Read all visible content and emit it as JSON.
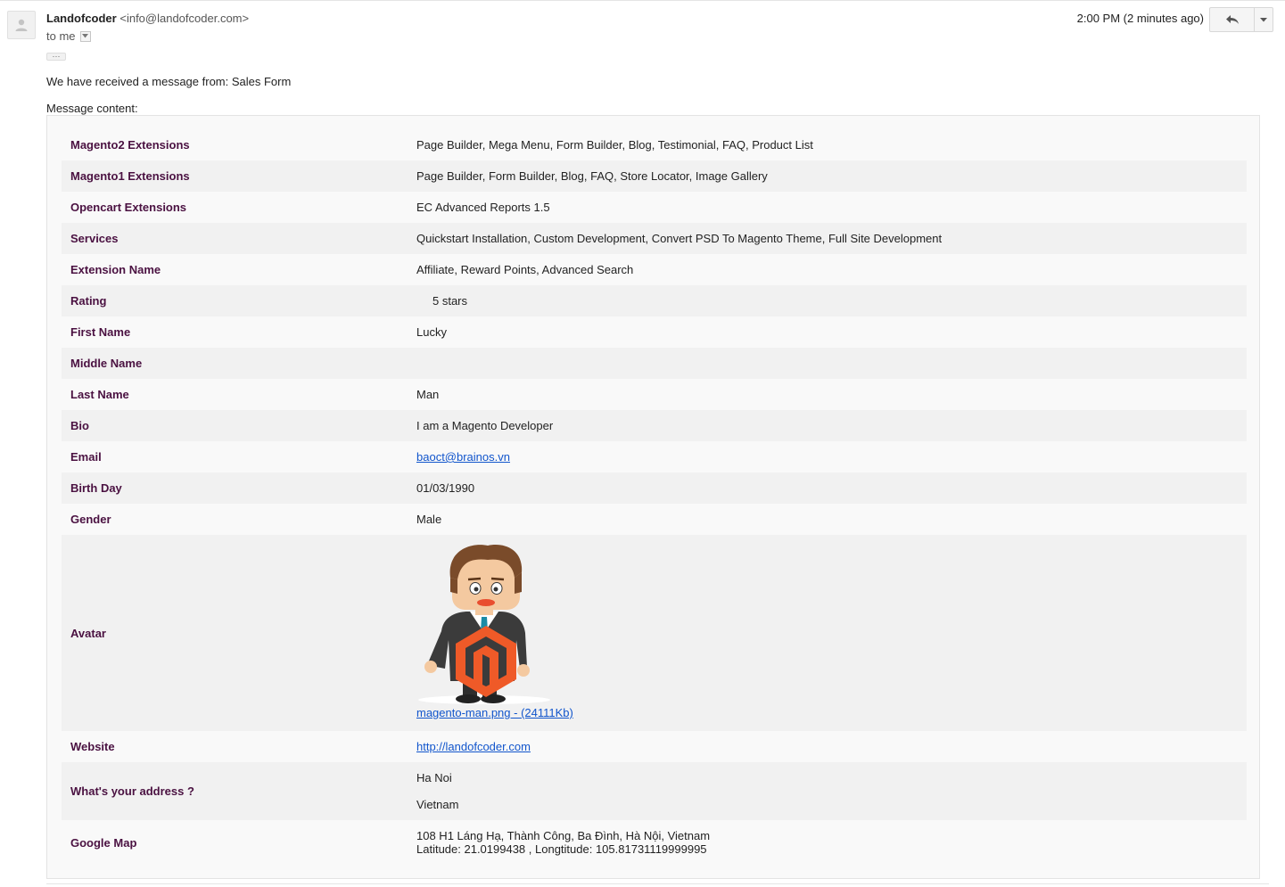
{
  "email": {
    "sender_name": "Landofcoder",
    "sender_email": "<info@landofcoder.com>",
    "recipient": "to me",
    "timestamp": "2:00 PM (2 minutes ago)",
    "ellipsis": "···",
    "intro": "We have received a message from: Sales Form",
    "content_label": "Message content:"
  },
  "fields": {
    "magento2": {
      "label": "Magento2 Extensions",
      "value": "Page Builder, Mega Menu, Form Builder, Blog, Testimonial, FAQ, Product List"
    },
    "magento1": {
      "label": "Magento1 Extensions",
      "value": "Page Builder, Form Builder, Blog, FAQ, Store Locator, Image Gallery"
    },
    "opencart": {
      "label": "Opencart Extensions",
      "value": "EC Advanced Reports 1.5"
    },
    "services": {
      "label": "Services",
      "value": "Quickstart Installation, Custom Development, Convert PSD To Magento Theme, Full Site Development"
    },
    "extension_name": {
      "label": "Extension Name",
      "value": "Affiliate, Reward Points, Advanced Search"
    },
    "rating": {
      "label": "Rating",
      "value": "5 stars"
    },
    "first_name": {
      "label": "First Name",
      "value": "Lucky"
    },
    "middle_name": {
      "label": "Middle Name",
      "value": ""
    },
    "last_name": {
      "label": "Last Name",
      "value": "Man"
    },
    "bio": {
      "label": "Bio",
      "value": "I am a Magento Developer"
    },
    "email": {
      "label": "Email",
      "value": "baoct@brainos.vn"
    },
    "birth_day": {
      "label": "Birth Day",
      "value": "01/03/1990"
    },
    "gender": {
      "label": "Gender",
      "value": "Male"
    },
    "avatar": {
      "label": "Avatar",
      "link": "magento-man.png - (24111Kb)"
    },
    "website": {
      "label": "Website",
      "value": "http://landofcoder.com"
    },
    "address": {
      "label": "What's your address ?",
      "line1": "Ha Noi",
      "line2": "Vietnam"
    },
    "google_map": {
      "label": "Google Map",
      "line1": "108 H1 Láng Hạ, Thành Công, Ba Đình, Hà Nội, Vietnam",
      "line2": "Latitude: 21.0199438 , Longtitude: 105.81731119999995"
    }
  },
  "colors": {
    "label": "#4a1141",
    "link": "#1155cc",
    "shade": "#f1f1f1",
    "panel": "#f9f9f9",
    "logo_orange": "#ef5a28"
  },
  "icons": {
    "avatar": "person-icon",
    "reply": "reply-arrow-icon",
    "more": "caret-down-icon"
  }
}
